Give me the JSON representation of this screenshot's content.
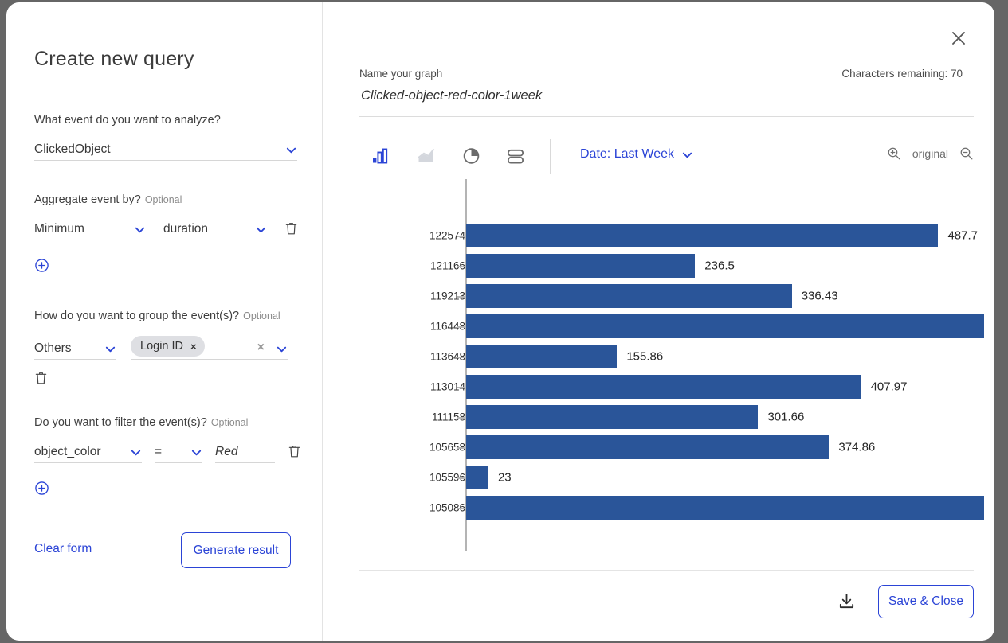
{
  "dialog": {
    "title": "Create new query",
    "close_icon": "close-icon"
  },
  "form": {
    "event_question": "What event do you want to analyze?",
    "event_value": "ClickedObject",
    "aggregate_question": "Aggregate event by?",
    "aggregate_optional": "Optional",
    "aggregate_func": "Minimum",
    "aggregate_field": "duration",
    "group_question": "How do you want to group the event(s)?",
    "group_optional": "Optional",
    "group_type": "Others",
    "group_chip": "Login ID",
    "chip_remove": "×",
    "group_clear": "×",
    "filter_question": "Do you want to filter the event(s)?",
    "filter_optional": "Optional",
    "filter_field": "object_color",
    "filter_op": "=",
    "filter_value": "Red",
    "clear_form": "Clear form",
    "generate_result": "Generate result"
  },
  "graph_header": {
    "name_label": "Name your graph",
    "name_value": "Clicked-object-red-color-1week",
    "name_placeholder": "Name your graph",
    "chars_remaining": "Characters remaining: 70"
  },
  "toolbar": {
    "icons": [
      {
        "name": "bar-chart-icon",
        "label": "Bar chart",
        "active": true
      },
      {
        "name": "area-chart-icon",
        "label": "Area chart",
        "active": false
      },
      {
        "name": "pie-chart-icon",
        "label": "Pie chart",
        "active": false
      },
      {
        "name": "table-view-icon",
        "label": "Table view",
        "active": false
      }
    ],
    "date_filter": "Date: Last Week",
    "zoom_in_icon": "zoom-in-icon",
    "zoom_label": "original",
    "zoom_out_icon": "zoom-out-icon"
  },
  "footer": {
    "download_icon": "download-icon",
    "save_close": "Save & Close"
  },
  "colors": {
    "bar": "#2a5599",
    "accent": "#2b44d6",
    "backdrop": "#666666"
  },
  "chart_data": {
    "type": "bar",
    "orientation": "horizontal",
    "title": "",
    "xlabel": "",
    "ylabel": "",
    "grid": false,
    "legend": false,
    "categories": [
      "122574",
      "121166",
      "119213",
      "116448",
      "113648",
      "113014",
      "111158",
      "105658",
      "105596",
      "105086"
    ],
    "values": [
      487.7,
      236.5,
      336.43,
      535,
      155.86,
      407.97,
      301.66,
      374.86,
      23,
      535
    ],
    "labels": [
      "487.7",
      "236.5",
      "336.43",
      "",
      "155.86",
      "407.97",
      "301.66",
      "374.86",
      "23",
      ""
    ],
    "xlim": [
      0,
      540
    ],
    "series": [
      {
        "name": "Minimum duration",
        "values": [
          487.7,
          236.5,
          336.43,
          535,
          155.86,
          407.97,
          301.66,
          374.86,
          23,
          535
        ]
      }
    ]
  }
}
